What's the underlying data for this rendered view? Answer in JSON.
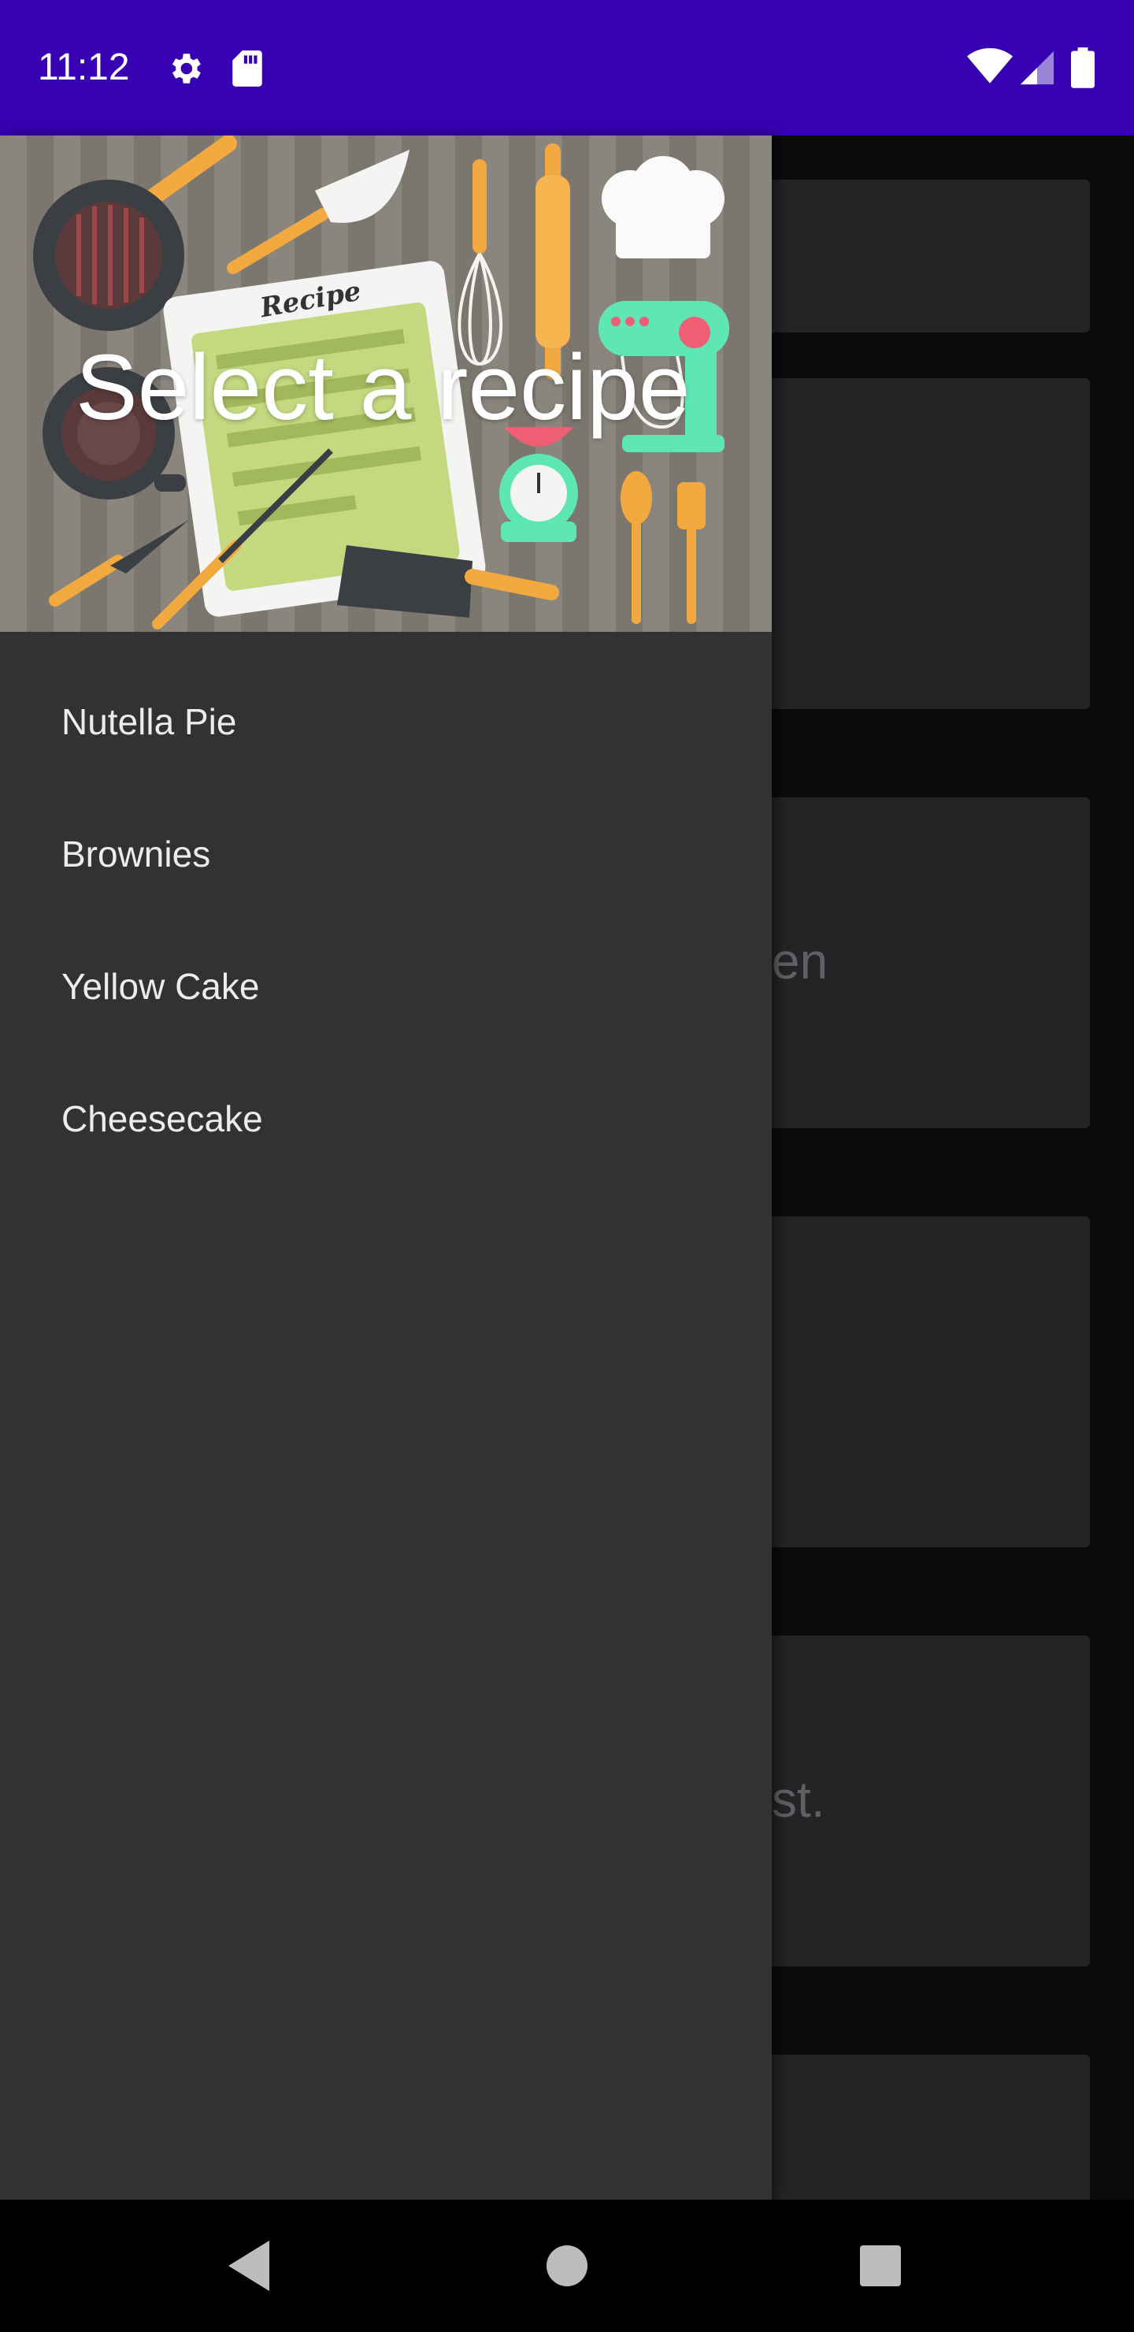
{
  "status_bar": {
    "time": "11:12",
    "icons": [
      "settings-icon",
      "sd-card-icon",
      "wifi-icon",
      "signal-icon",
      "battery-icon"
    ]
  },
  "drawer": {
    "header_title": "Select a recipe",
    "menu_items": [
      {
        "label": "Nutella Pie"
      },
      {
        "label": "Brownies"
      },
      {
        "label": "Yellow Cake"
      },
      {
        "label": "Cheesecake"
      }
    ]
  },
  "background": {
    "card_fragments": [
      "en",
      "st."
    ]
  },
  "nav_bar": {
    "buttons": [
      "back-icon",
      "home-icon",
      "recents-icon"
    ]
  },
  "colors": {
    "status_bar": "#3700b3",
    "drawer_bg": "#323232",
    "scrim": "#0b0b0b",
    "card_bg": "#222426"
  }
}
